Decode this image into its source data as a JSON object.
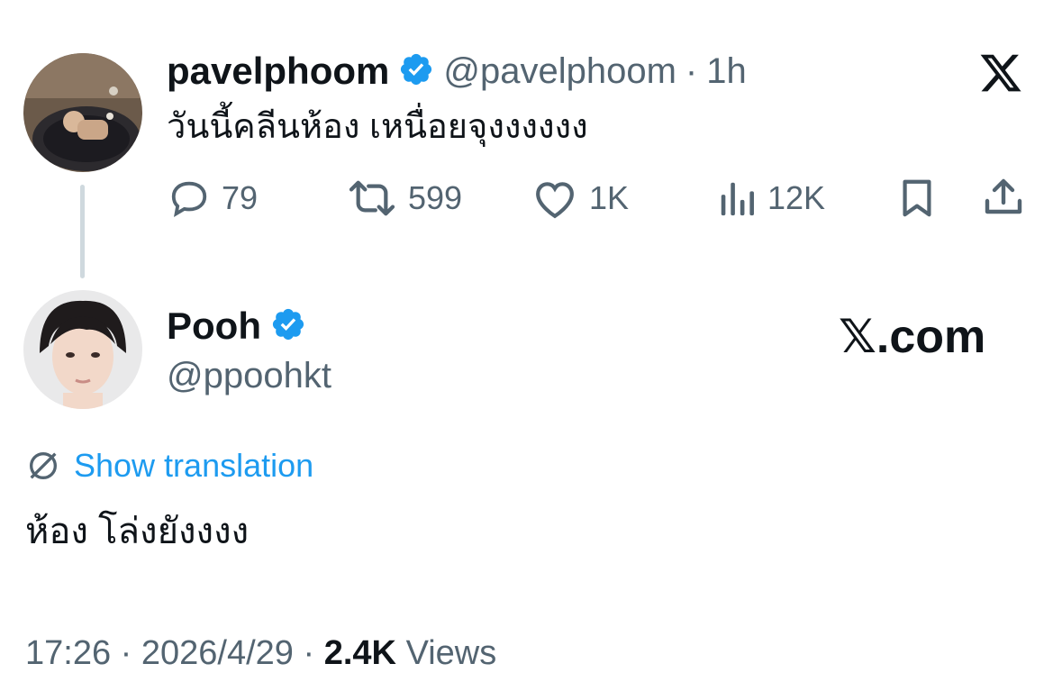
{
  "original_tweet": {
    "display_name": "pavelphoom",
    "handle": "@pavelphoom",
    "separator": "·",
    "time_ago": "1h",
    "text": "วันนี้คลีนห้อง เหนื่อยจุงงงงงง",
    "verified": true,
    "actions": {
      "replies": "79",
      "reposts": "599",
      "likes": "1K",
      "views": "12K"
    },
    "platform_icon": "x-logo-icon"
  },
  "reply": {
    "display_name": "Pooh",
    "handle": "@ppoohkt",
    "verified": true,
    "watermark": "𝕏.com",
    "show_translation_label": "Show translation",
    "text": "ห้อง โล่งยังงงง",
    "time": "17:26",
    "dot1": "·",
    "date": "2026/4/29",
    "dot2": "·",
    "view_count": "2.4K",
    "views_label": "Views"
  },
  "colors": {
    "verified_blue": "#1d9bf0",
    "link_blue": "#1d9bf0",
    "secondary_text": "#536471",
    "primary_text": "#0f1419"
  }
}
